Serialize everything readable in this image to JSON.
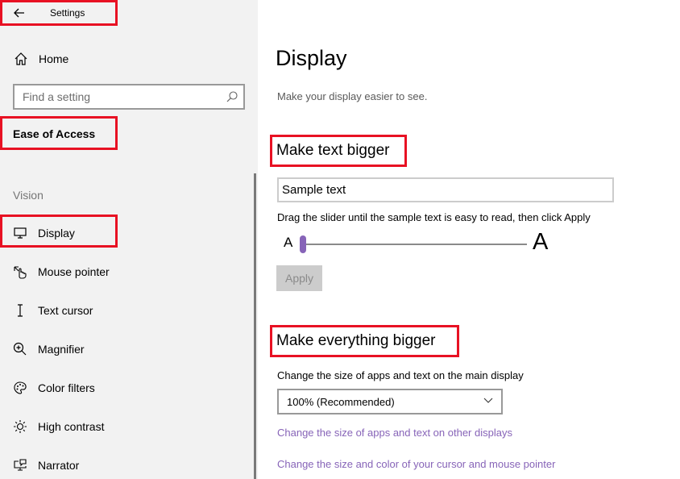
{
  "window": {
    "title": "Settings"
  },
  "sidebar": {
    "home_label": "Home",
    "search": {
      "placeholder": "Find a setting",
      "value": ""
    },
    "section_title": "Ease of Access",
    "group_label": "Vision",
    "items": [
      {
        "label": "Display",
        "icon": "display-icon",
        "active": true
      },
      {
        "label": "Mouse pointer",
        "icon": "mouse-pointer-icon"
      },
      {
        "label": "Text cursor",
        "icon": "text-cursor-icon"
      },
      {
        "label": "Magnifier",
        "icon": "magnifier-icon"
      },
      {
        "label": "Color filters",
        "icon": "color-palette-icon"
      },
      {
        "label": "High contrast",
        "icon": "high-contrast-icon"
      },
      {
        "label": "Narrator",
        "icon": "narrator-icon"
      }
    ]
  },
  "main": {
    "title": "Display",
    "subtitle": "Make your display easier to see.",
    "text_bigger": {
      "heading": "Make text bigger",
      "sample_text": "Sample text",
      "help": "Drag the slider until the sample text is easy to read, then click Apply",
      "slider_min_label": "A",
      "slider_max_label": "A",
      "slider_value_percent": 0,
      "apply_label": "Apply"
    },
    "everything_bigger": {
      "heading": "Make everything bigger",
      "label": "Change the size of apps and text on the main display",
      "selected": "100% (Recommended)",
      "links": [
        "Change the size of apps and text on other displays",
        "Change the size and color of your cursor and mouse pointer"
      ]
    }
  },
  "colors": {
    "accent": "#8764b8",
    "highlight_box": "#e81123",
    "sidebar_bg": "#f2f2f2"
  }
}
